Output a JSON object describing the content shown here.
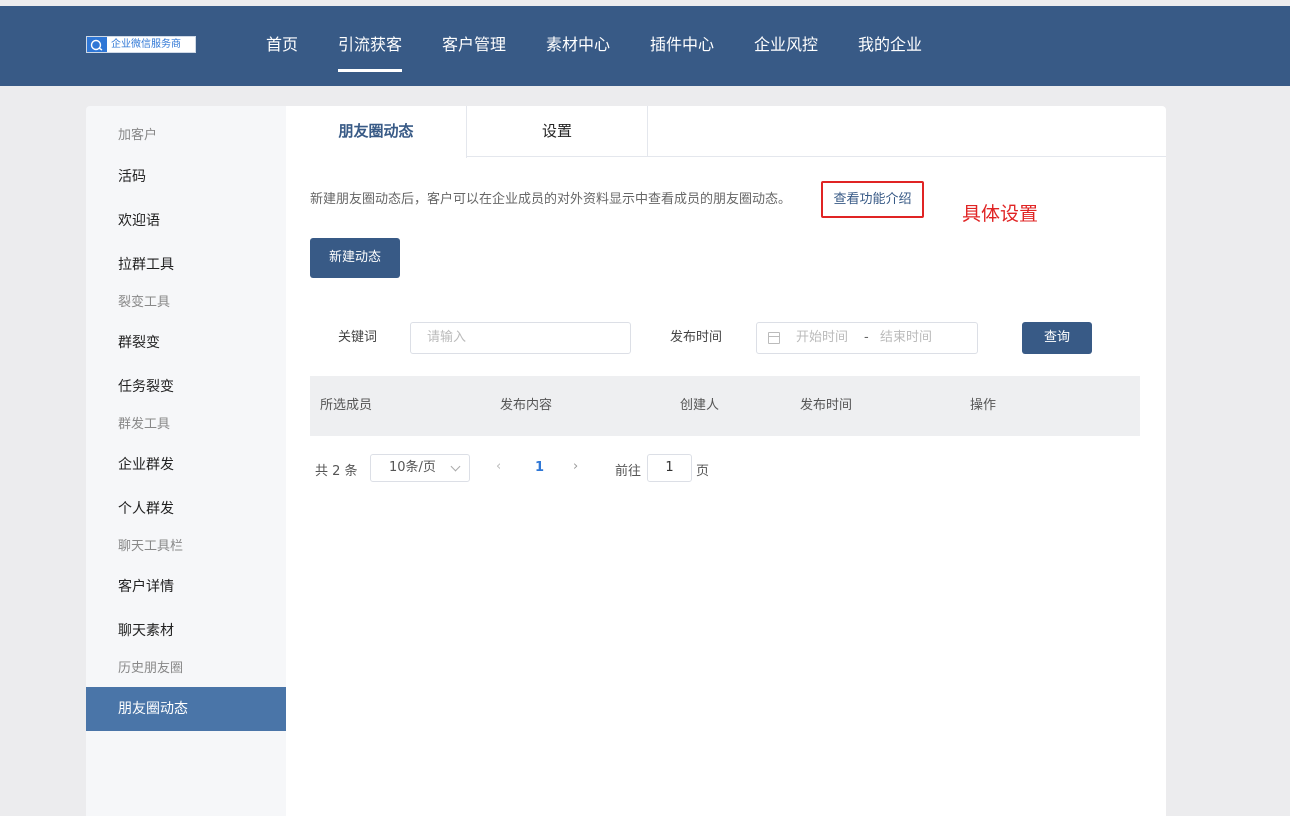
{
  "header": {
    "logo_text": "企业微信服务商",
    "nav": [
      {
        "label": "首页"
      },
      {
        "label": "引流获客"
      },
      {
        "label": "客户管理"
      },
      {
        "label": "素材中心"
      },
      {
        "label": "插件中心"
      },
      {
        "label": "企业风控"
      },
      {
        "label": "我的企业"
      }
    ],
    "active_nav": "引流获客"
  },
  "sidebar": {
    "items": [
      {
        "label": "加客户",
        "type": "group"
      },
      {
        "label": "活码",
        "type": "item"
      },
      {
        "label": "欢迎语",
        "type": "item"
      },
      {
        "label": "拉群工具",
        "type": "item"
      },
      {
        "label": "裂变工具",
        "type": "group"
      },
      {
        "label": "群裂变",
        "type": "item"
      },
      {
        "label": "任务裂变",
        "type": "item"
      },
      {
        "label": "群发工具",
        "type": "group"
      },
      {
        "label": "企业群发",
        "type": "item"
      },
      {
        "label": "个人群发",
        "type": "item"
      },
      {
        "label": "聊天工具栏",
        "type": "group"
      },
      {
        "label": "客户详情",
        "type": "item"
      },
      {
        "label": "聊天素材",
        "type": "item"
      },
      {
        "label": "历史朋友圈",
        "type": "group"
      },
      {
        "label": "朋友圈动态",
        "type": "item"
      }
    ],
    "active": "朋友圈动态"
  },
  "tabs": [
    {
      "label": "朋友圈动态"
    },
    {
      "label": "设置"
    }
  ],
  "main": {
    "description": "新建朋友圈动态后，客户可以在企业成员的对外资料显示中查看成员的朋友圈动态。",
    "intro_link": "查看功能介绍",
    "annotation": "具体设置",
    "new_button": "新建动态",
    "filters": {
      "keyword_label": "关键词",
      "keyword_placeholder": "请输入",
      "time_label": "发布时间",
      "start_placeholder": "开始时间",
      "range_separator": "-",
      "end_placeholder": "结束时间",
      "query_button": "查询"
    },
    "table": {
      "columns": [
        "所选成员",
        "发布内容",
        "创建人",
        "发布时间",
        "操作"
      ]
    },
    "pagination": {
      "total_text": "共 2 条",
      "page_size": "10条/页",
      "prev": "‹",
      "current_page": "1",
      "next": "›",
      "goto_label": "前往",
      "goto_value": "1",
      "goto_suffix": "页"
    }
  },
  "colors": {
    "header_bg": "#385a86",
    "sidebar_active": "#4a75a8",
    "annotation": "#e02424",
    "link": "#385a86"
  }
}
